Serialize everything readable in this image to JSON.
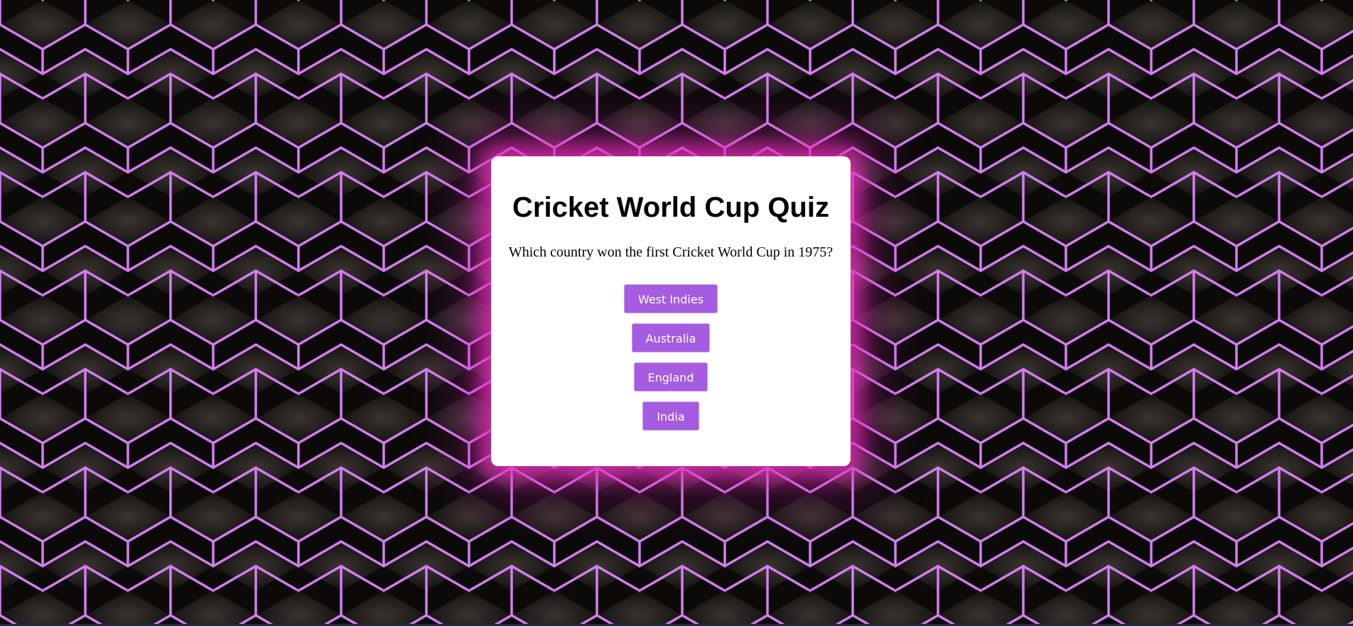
{
  "quiz": {
    "title": "Cricket World Cup Quiz",
    "question": "Which country won the first Cricket World Cup in 1975?",
    "options": [
      "West Indies",
      "Australia",
      "England",
      "India"
    ]
  },
  "colors": {
    "background": "#0b0a09",
    "pattern_line": "#d47ef3",
    "card": "#ffffff",
    "card_glow": "#ec2cbe",
    "button": "#a55ce0",
    "button_text": "#ffffff"
  }
}
